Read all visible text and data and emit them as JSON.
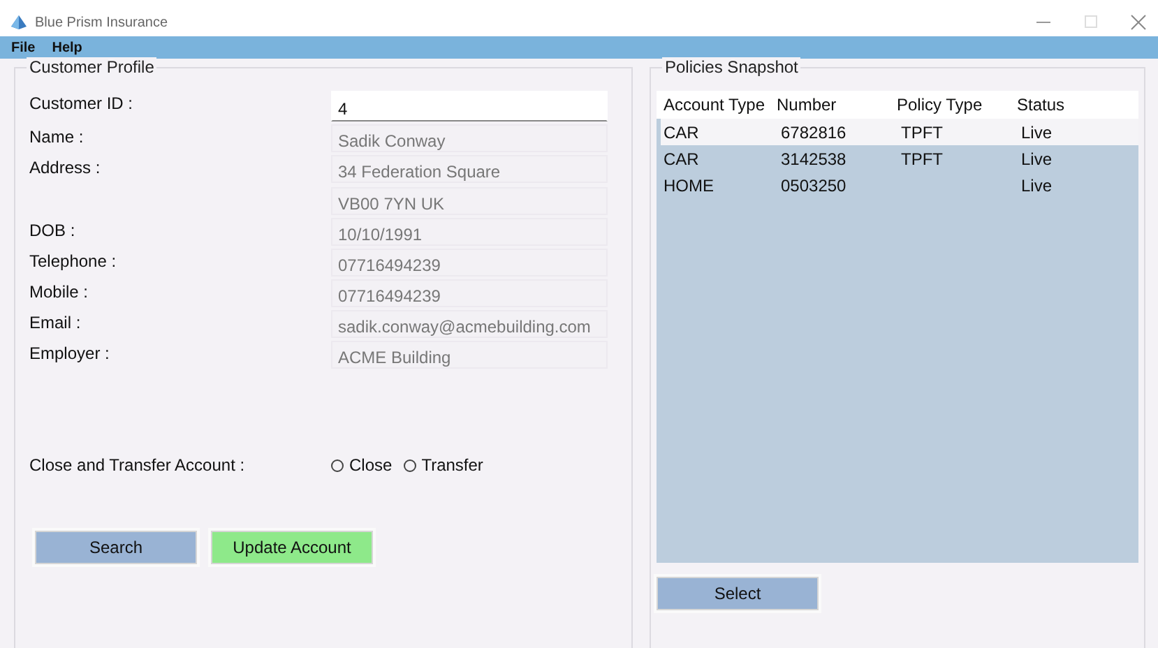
{
  "window": {
    "title": "Blue Prism Insurance"
  },
  "menu": [
    "File",
    "Help"
  ],
  "customer_profile": {
    "title": "Customer Profile",
    "fields": [
      {
        "label": "Customer ID :",
        "values": [
          "4"
        ],
        "editable": true
      },
      {
        "label": "Name :",
        "values": [
          "Sadik Conway"
        ],
        "editable": false
      },
      {
        "label": "Address :",
        "values": [
          "34 Federation Square",
          "VB00 7YN UK"
        ],
        "editable": false
      },
      {
        "label": "DOB :",
        "values": [
          "10/10/1991"
        ],
        "editable": false
      },
      {
        "label": "Telephone :",
        "values": [
          "07716494239"
        ],
        "editable": false
      },
      {
        "label": "Mobile :",
        "values": [
          "07716494239"
        ],
        "editable": false
      },
      {
        "label": "Email :",
        "values": [
          "sadik.conway@acmebuilding.com"
        ],
        "editable": false
      },
      {
        "label": "Employer :",
        "values": [
          "ACME Building"
        ],
        "editable": false
      }
    ],
    "close_transfer": {
      "label": "Close and Transfer Account :",
      "options": [
        {
          "label": "Close",
          "selected": false
        },
        {
          "label": "Transfer",
          "selected": false
        }
      ]
    },
    "buttons": [
      {
        "label": "Search",
        "kind": "primary"
      },
      {
        "label": "Update Account",
        "kind": "success"
      }
    ]
  },
  "policies": {
    "title": "Policies Snapshot",
    "columns": [
      "Account Type",
      "Number",
      "Policy Type",
      "Status"
    ],
    "rows": [
      {
        "cells": [
          "CAR",
          "6782816",
          "TPFT",
          "Live"
        ],
        "selected": false
      },
      {
        "cells": [
          "CAR",
          "3142538",
          "TPFT",
          "Live"
        ],
        "selected": true
      },
      {
        "cells": [
          "HOME",
          "0503250",
          "",
          "Live"
        ],
        "selected": true
      }
    ],
    "button": "Select"
  }
}
